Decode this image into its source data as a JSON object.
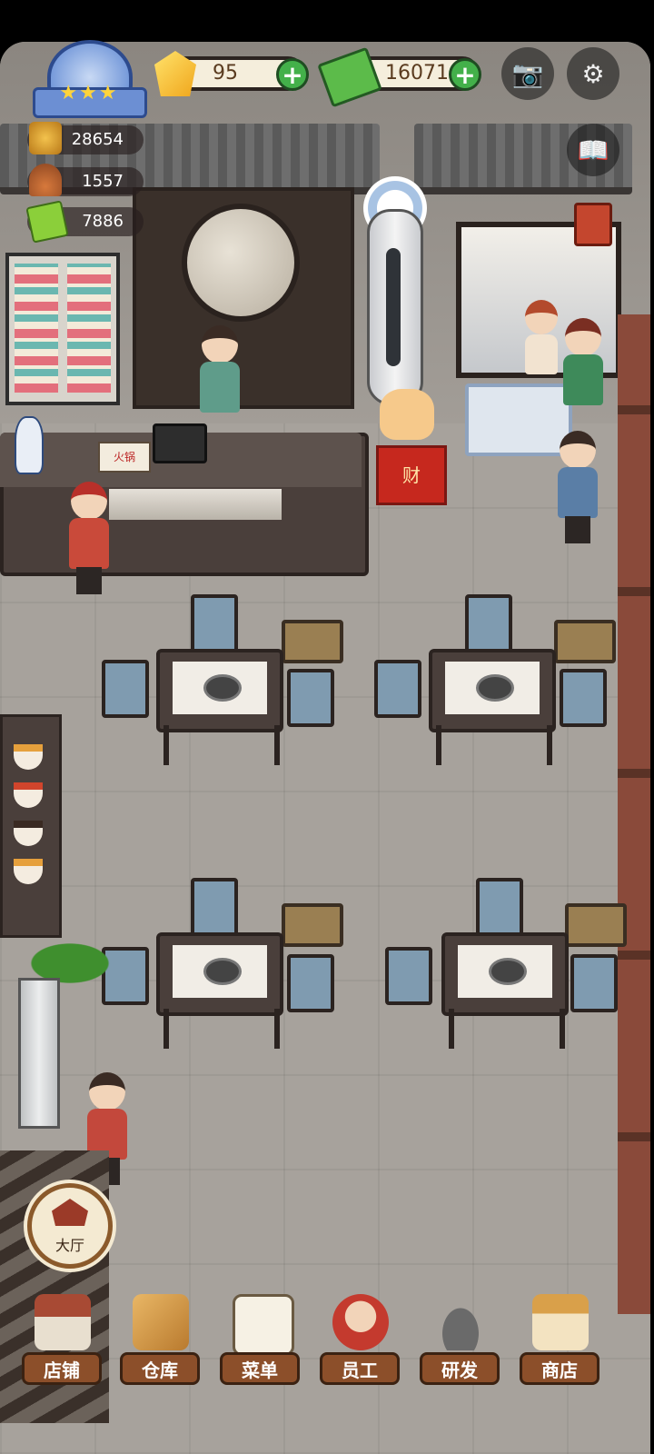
{
  "currency": {
    "gems": "95",
    "cash": "16071"
  },
  "stats": [
    {
      "icon": "pot-icon",
      "value": "28654"
    },
    {
      "icon": "service-bell-icon",
      "value": "1557"
    },
    {
      "icon": "ticket-icon",
      "value": "7886"
    }
  ],
  "lucky_cat_sign": "财",
  "menu_card_text": "火锅",
  "hall_button": {
    "label": "大厅"
  },
  "bottom_nav": [
    {
      "label": "店铺",
      "icon": "shop-icon"
    },
    {
      "label": "仓库",
      "icon": "warehouse-boxes-icon"
    },
    {
      "label": "菜单",
      "icon": "menu-clipboard-icon"
    },
    {
      "label": "员工",
      "icon": "staff-icon"
    },
    {
      "label": "研发",
      "icon": "wok-research-icon"
    },
    {
      "label": "商店",
      "icon": "store-icon"
    }
  ],
  "colors": {
    "plus_button": "#43b04a",
    "nav_plate": "#8c4f2a",
    "floor": "#a7a29c"
  }
}
